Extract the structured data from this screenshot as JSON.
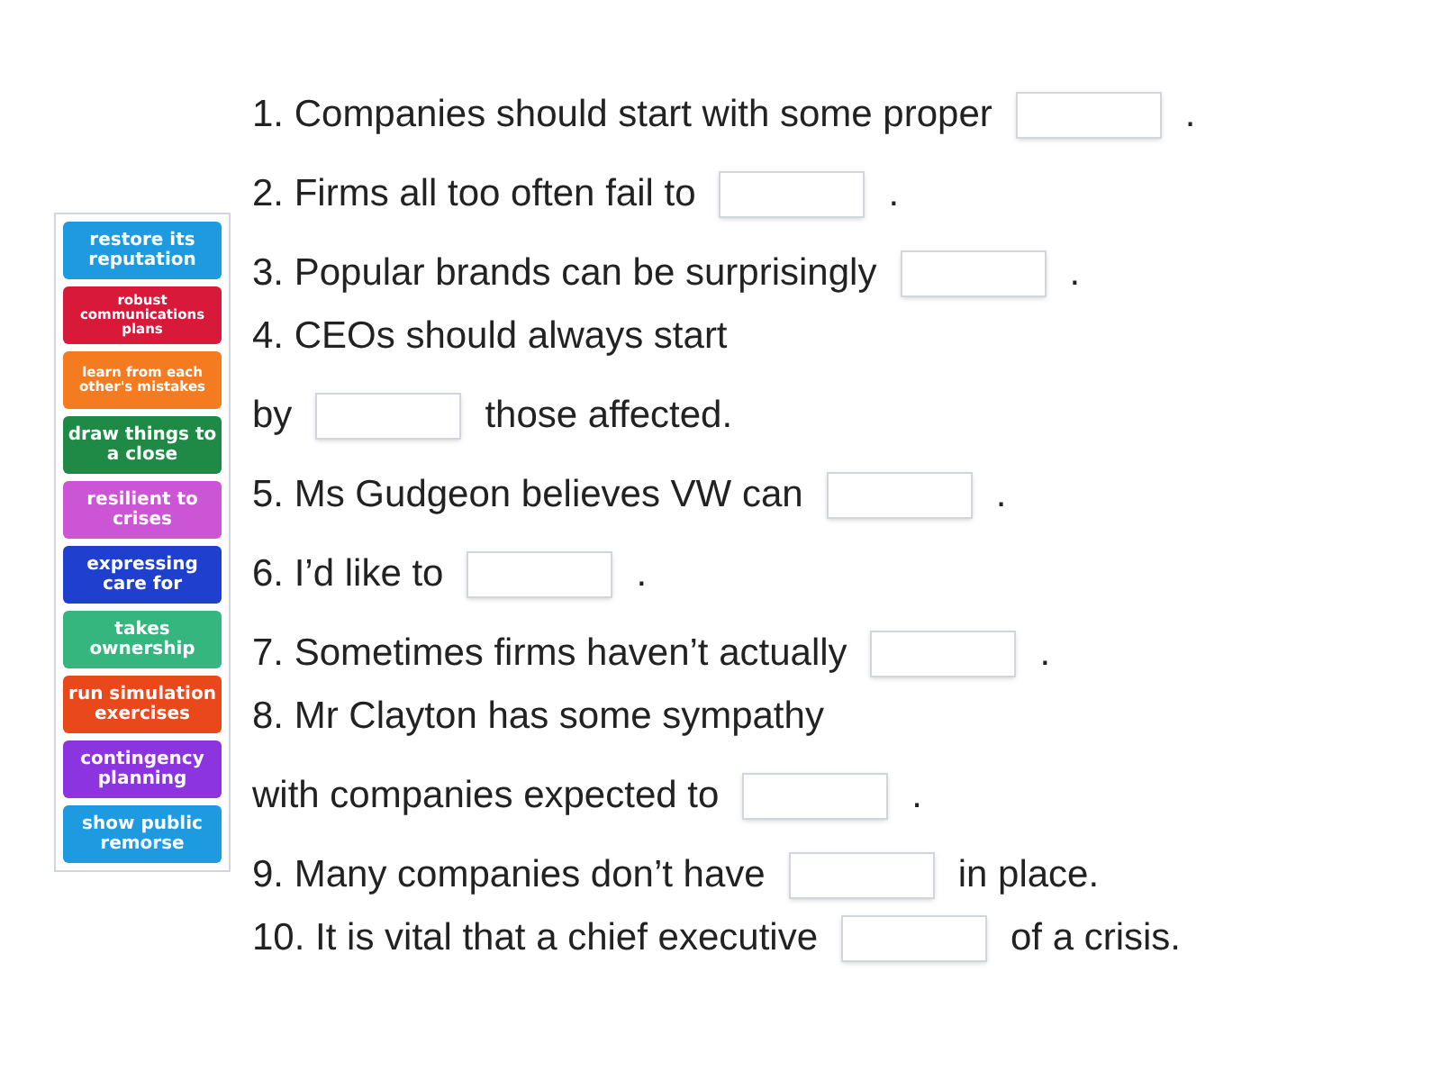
{
  "answer_tiles": [
    {
      "label": "restore its reputation",
      "color": "#1e9be0"
    },
    {
      "label": "robust communications plans",
      "color": "#d8193a"
    },
    {
      "label": "learn from each other's mistakes",
      "color": "#f47b20"
    },
    {
      "label": "draw things to a close",
      "color": "#1f8a45"
    },
    {
      "label": "resilient to crises",
      "color": "#cc55d6"
    },
    {
      "label": "expressing care for",
      "color": "#1f3fcf"
    },
    {
      "label": "takes ownership",
      "color": "#34b67e"
    },
    {
      "label": "run simulation exercises",
      "color": "#e9481b"
    },
    {
      "label": "contingency planning",
      "color": "#8b34e0"
    },
    {
      "label": "show public remorse",
      "color": "#1e9be0"
    }
  ],
  "lines": [
    {
      "parts": [
        {
          "kind": "text",
          "text": "1. Companies should start with some proper"
        },
        {
          "kind": "blank"
        },
        {
          "kind": "text",
          "text": "."
        }
      ]
    },
    {
      "parts": [
        {
          "kind": "text",
          "text": "2. Firms all too often fail to"
        },
        {
          "kind": "blank"
        },
        {
          "kind": "text",
          "text": "."
        }
      ]
    },
    {
      "parts": [
        {
          "kind": "text",
          "text": "3. Popular brands can be surprisingly"
        },
        {
          "kind": "blank"
        },
        {
          "kind": "text",
          "text": "."
        }
      ]
    },
    {
      "parts": [
        {
          "kind": "text",
          "text": "4. CEOs should always start"
        }
      ]
    },
    {
      "parts": [
        {
          "kind": "text",
          "text": "by"
        },
        {
          "kind": "blank"
        },
        {
          "kind": "text",
          "text": "those affected."
        }
      ]
    },
    {
      "parts": [
        {
          "kind": "text",
          "text": "5. Ms Gudgeon believes VW can"
        },
        {
          "kind": "blank"
        },
        {
          "kind": "text",
          "text": "."
        }
      ]
    },
    {
      "parts": [
        {
          "kind": "text",
          "text": "6. I’d like to"
        },
        {
          "kind": "blank"
        },
        {
          "kind": "text",
          "text": "."
        }
      ]
    },
    {
      "parts": [
        {
          "kind": "text",
          "text": "7. Sometimes firms haven’t actually"
        },
        {
          "kind": "blank"
        },
        {
          "kind": "text",
          "text": "."
        }
      ]
    },
    {
      "parts": [
        {
          "kind": "text",
          "text": "8. Mr Clayton has some sympathy"
        }
      ]
    },
    {
      "parts": [
        {
          "kind": "text",
          "text": "with companies expected to"
        },
        {
          "kind": "blank"
        },
        {
          "kind": "text",
          "text": "."
        }
      ]
    },
    {
      "parts": [
        {
          "kind": "text",
          "text": "9. Many companies don’t have"
        },
        {
          "kind": "blank"
        },
        {
          "kind": "text",
          "text": "in place."
        }
      ]
    },
    {
      "parts": [
        {
          "kind": "text",
          "text": "10. It is vital that a chief executive"
        },
        {
          "kind": "blank"
        },
        {
          "kind": "text",
          "text": "of a crisis."
        }
      ]
    }
  ]
}
